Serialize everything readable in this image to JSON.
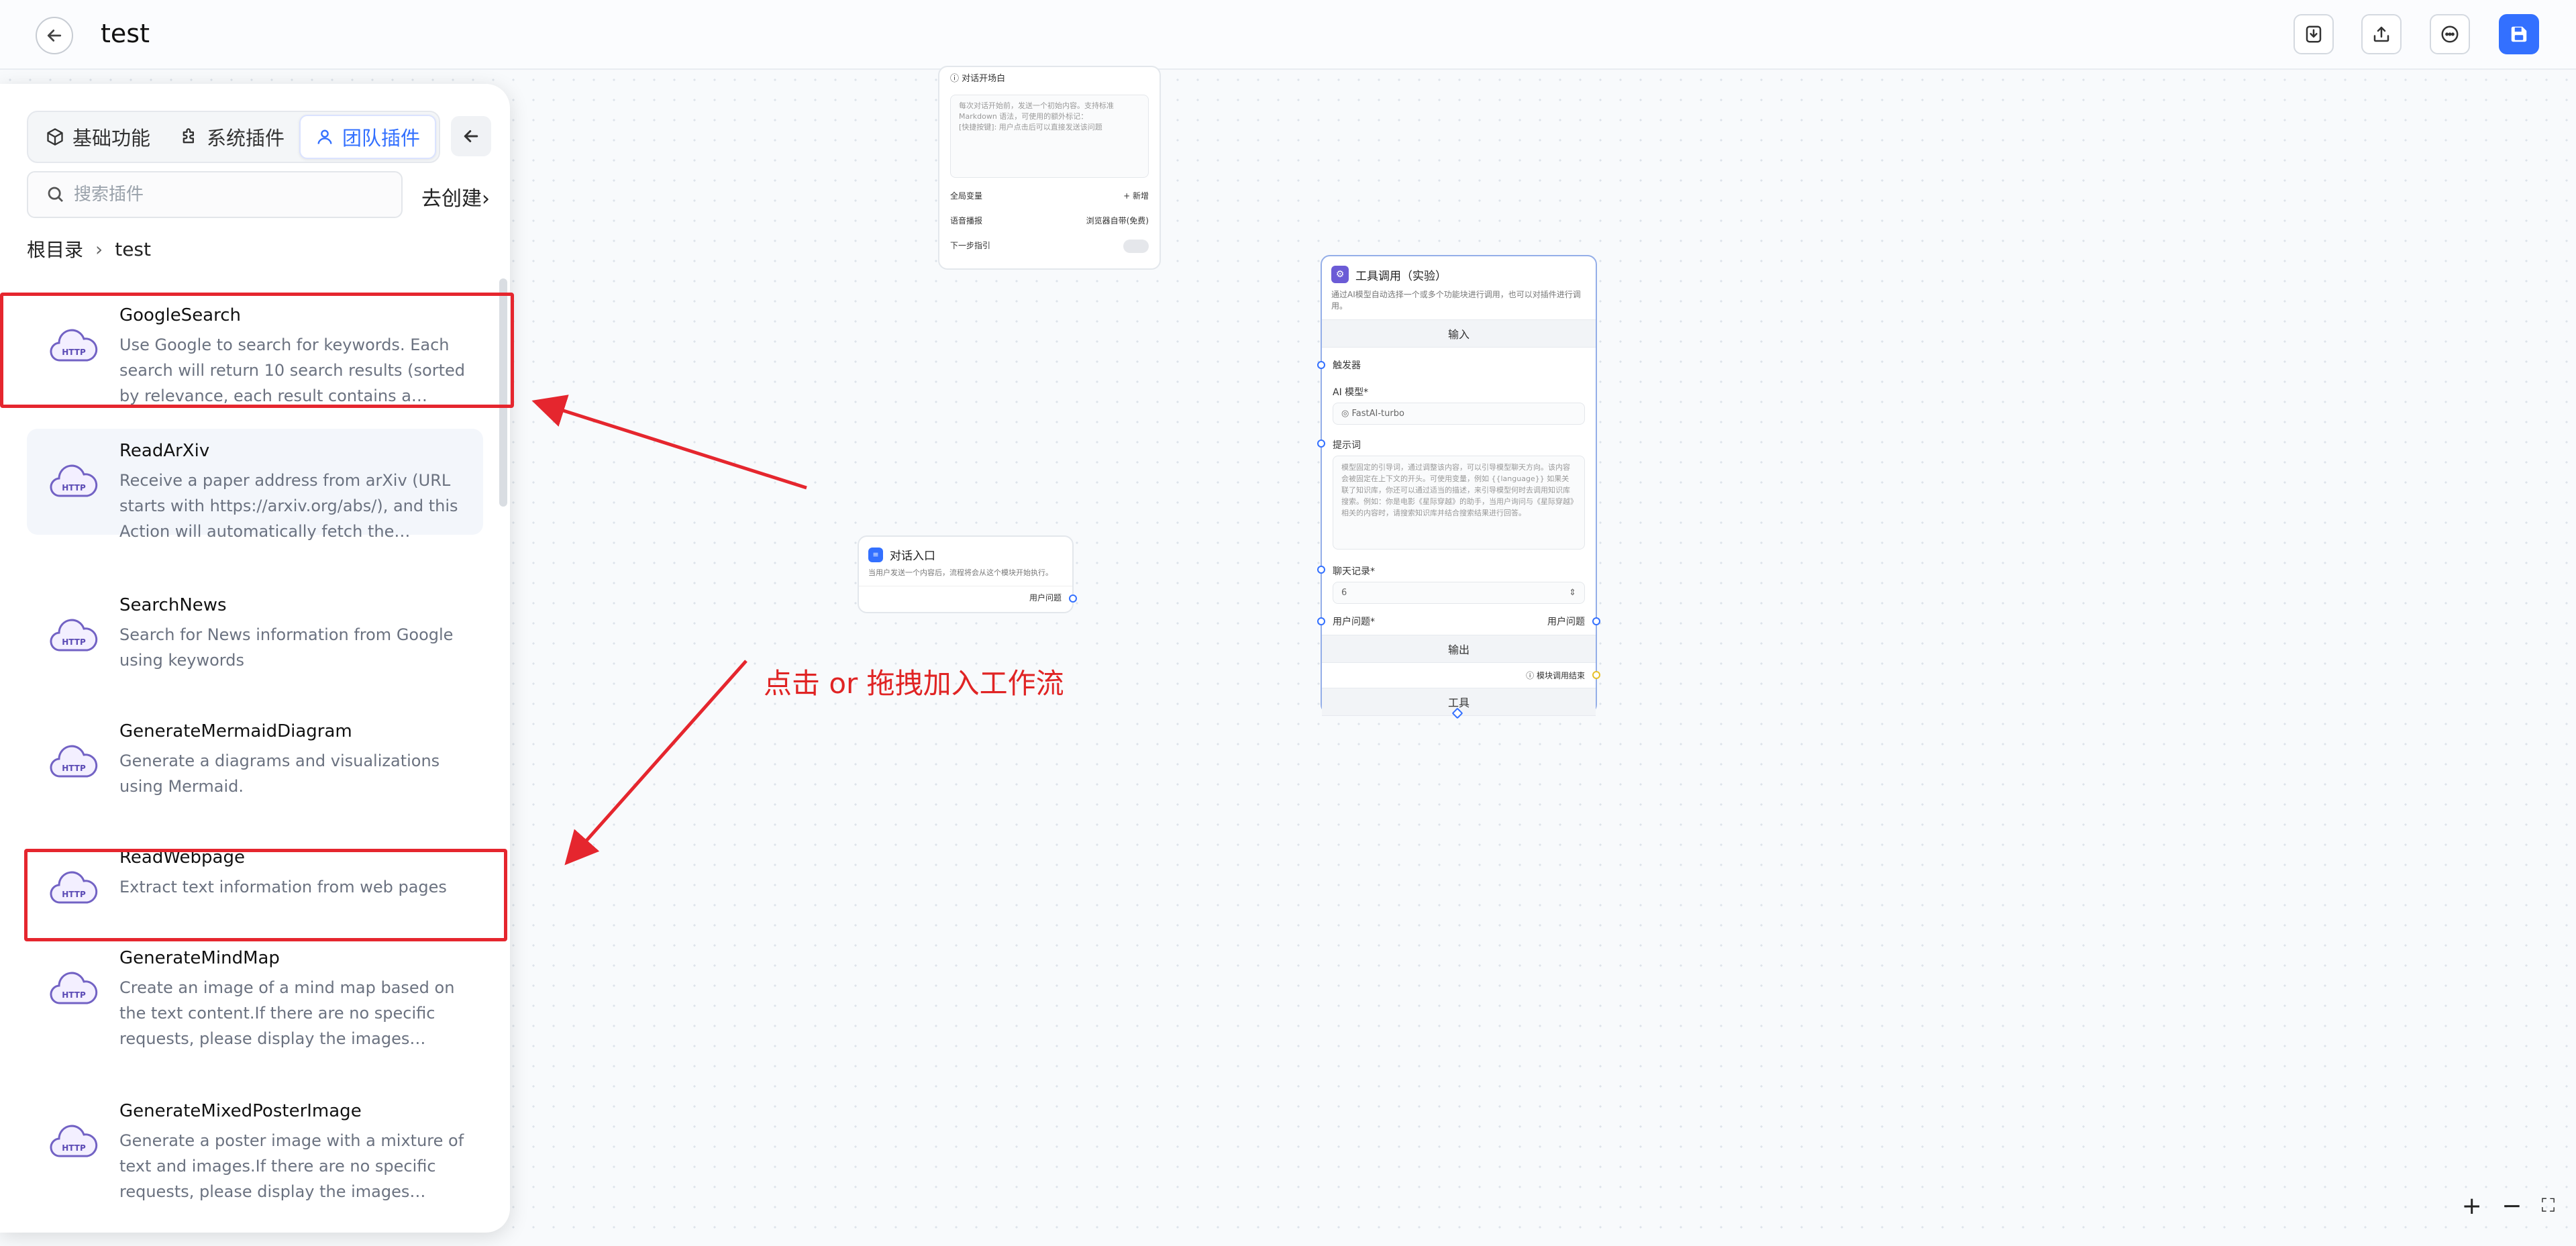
{
  "header": {
    "title": "test",
    "back_icon": "arrow-left-icon",
    "actions": [
      "import-icon",
      "export-icon",
      "chat-icon",
      "save-icon"
    ],
    "accent": "#3370ff"
  },
  "panel": {
    "tabs": [
      {
        "label": "基础功能",
        "icon": "cube-icon"
      },
      {
        "label": "系统插件",
        "icon": "puzzle-icon"
      },
      {
        "label": "团队插件",
        "icon": "user-icon",
        "active": true
      }
    ],
    "search_placeholder": "搜索插件",
    "goto_create": "去创建",
    "breadcrumb": [
      "根目录",
      "test"
    ],
    "plugins": [
      {
        "name": "GoogleSearch",
        "desc": "Use Google to search for keywords. Each search will return 10 search results (sorted by relevance, each result contains a website..."
      },
      {
        "name": "ReadArXiv",
        "desc": "Receive a paper address from arXiv (URL starts with https://arxiv.org/abs/), and this Action will automatically fetch the content..."
      },
      {
        "name": "SearchNews",
        "desc": "Search for News information from Google using keywords"
      },
      {
        "name": "GenerateMermaidDiagram",
        "desc": "Generate a diagrams and visualizations using Mermaid."
      },
      {
        "name": "ReadWebpage",
        "desc": "Extract text information from web pages"
      },
      {
        "name": "GenerateMindMap",
        "desc": "Create an image of a mind map based on the text content.If there are no specific requests, please display the images directl..."
      },
      {
        "name": "GenerateMixedPosterImage",
        "desc": "Generate a poster image with a mixture of text and images.If there are no specific requests, please display the images directl..."
      }
    ]
  },
  "annotation": {
    "text": "点击 or 拖拽加入工作流",
    "color": "#e02424"
  },
  "welcome_node": {
    "label": "对话开场白",
    "hint": "每次对话开始前，发送一个初始内容。支持标准 Markdown 语法，可使用的额外标记：",
    "hint2": "[快捷按键]: 用户点击后可以直接发送该问题",
    "global_vars": "全局变量",
    "add": "+ 新增",
    "voice": "语音播报",
    "voice_value": "浏览器自带(免费)",
    "next_guide": "下一步指引"
  },
  "start_node": {
    "title": "对话入口",
    "desc": "当用户发送一个内容后，流程将会从这个模块开始执行。",
    "output": "用户问题"
  },
  "tool_node": {
    "title": "工具调用（实验）",
    "desc": "通过AI模型自动选择一个或多个功能块进行调用，也可以对插件进行调用。",
    "input_section": "输入",
    "trigger": "触发器",
    "model_label": "AI 模型*",
    "model_value": "FastAI-turbo",
    "prompt_label": "提示词",
    "prompt_text": "模型固定的引导词，通过调整该内容，可以引导模型聊天方向。该内容会被固定在上下文的开头。可使用变量，例如 {{language}} 如果关联了知识库，你还可以通过适当的描述，来引导模型何时去调用知识库搜索。例如：你是电影《星际穿越》的助手，当用户询问与《星际穿越》相关的内容时，请搜索知识库并结合搜索结果进行回答。",
    "history_label": "聊天记录*",
    "history_value": "6",
    "question_label": "用户问题*",
    "question_out": "用户问题",
    "output_section": "输出",
    "done_label": "模块调用结束",
    "tools_section": "工具"
  },
  "zoom": [
    "+",
    "−",
    "⛶"
  ]
}
